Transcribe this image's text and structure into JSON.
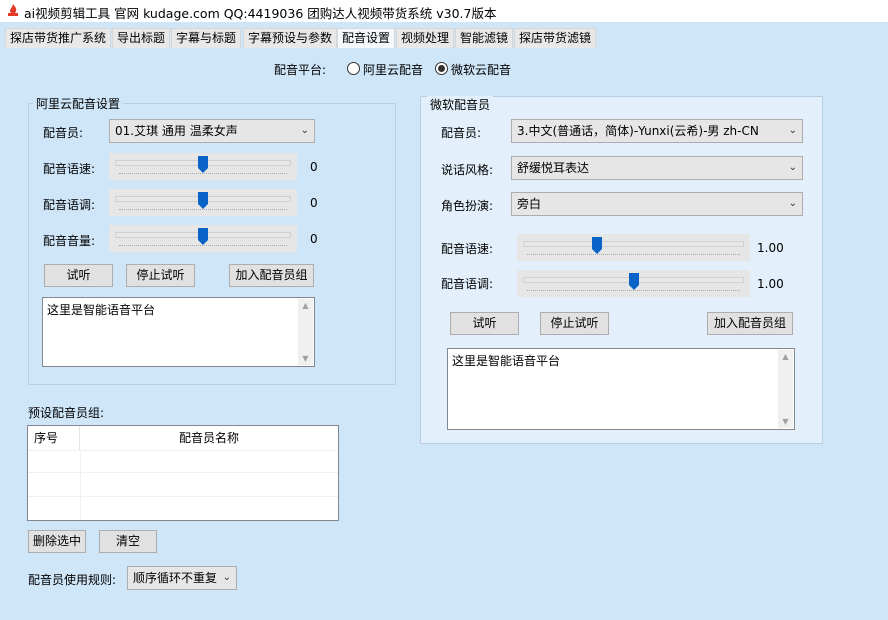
{
  "window": {
    "title": "ai视频剪辑工具 官网 kudage.com QQ:4419036    团购达人视频带货系统    v30.7版本",
    "icon": "flame-app-icon"
  },
  "tabs": [
    {
      "label": "探店带货推广系统",
      "active": false
    },
    {
      "label": "导出标题",
      "active": false
    },
    {
      "label": "字幕与标题",
      "active": false
    },
    {
      "label": "字幕预设与参数",
      "active": false
    },
    {
      "label": "配音设置",
      "active": true
    },
    {
      "label": "视频处理",
      "active": false
    },
    {
      "label": "智能滤镜",
      "active": false
    },
    {
      "label": "探店带货滤镜",
      "active": false
    }
  ],
  "platform": {
    "label": "配音平台:",
    "options": [
      {
        "label": "阿里云配音",
        "checked": false
      },
      {
        "label": "微软云配音",
        "checked": true
      }
    ]
  },
  "aliyun": {
    "group_title": "阿里云配音设置",
    "voice_label": "配音员:",
    "voice_value": "01.艾琪 通用 温柔女声",
    "speed_label": "配音语速:",
    "speed_value": "0",
    "speed_level": 0.5,
    "pitch_label": "配音语调:",
    "pitch_value": "0",
    "pitch_level": 0.5,
    "volume_label": "配音音量:",
    "volume_value": "0",
    "volume_level": 0.5,
    "btn_listen": "试听",
    "btn_stop": "停止试听",
    "btn_add": "加入配音员组",
    "text": "这里是智能语音平台"
  },
  "microsoft": {
    "group_title": "微软配音员",
    "voice_label": "配音员:",
    "voice_value": "3.中文(普通话，简体)-Yunxi(云希)-男 zh-CN",
    "style_label": "说话风格:",
    "style_value": "舒缓悦耳表达",
    "role_label": "角色扮演:",
    "role_value": "旁白",
    "speed_label": "配音语速:",
    "speed_value": "1.00",
    "speed_level": 0.33,
    "pitch_label": "配音语调:",
    "pitch_value": "1.00",
    "pitch_level": 0.5,
    "btn_listen": "试听",
    "btn_stop": "停止试听",
    "btn_add": "加入配音员组",
    "text": "这里是智能语音平台"
  },
  "preset": {
    "label": "预设配音员组:",
    "columns": [
      "序号",
      "配音员名称"
    ],
    "btn_delete": "删除选中",
    "btn_clear": "清空",
    "rule_label": "配音员使用规则:",
    "rule_value": "顺序循环不重复"
  },
  "colors": {
    "background": "#cfe6f8",
    "slider_thumb": "#0a64c8"
  }
}
